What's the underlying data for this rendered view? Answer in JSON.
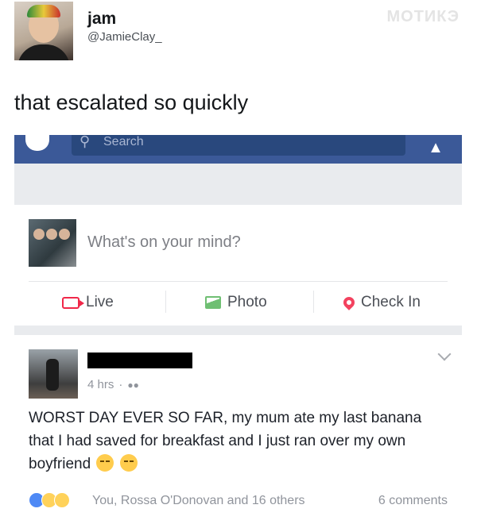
{
  "tweet": {
    "display_name": "jam",
    "handle": "@JamieClay_",
    "text": "that escalated so quickly",
    "watermark": "MOTИКЭ"
  },
  "facebook": {
    "search_placeholder": "Search",
    "composer": {
      "placeholder": "What's on your mind?",
      "actions": {
        "live": "Live",
        "photo": "Photo",
        "checkin": "Check In"
      }
    },
    "post": {
      "time": "4 hrs",
      "separator": "·",
      "body": "WORST DAY EVER SO FAR, my mum ate my last banana that I had saved for breakfast and I just ran over my own boyfriend",
      "reactions_text": "You, Rossa O'Donovan and 16 others",
      "comments_text": "6 comments"
    },
    "colors": {
      "topbar": "#3b5998",
      "background": "#e9ebee"
    },
    "icons": [
      "messenger-icon",
      "search-icon",
      "friend-requests-icon",
      "live-video-icon",
      "photo-icon",
      "location-pin-icon",
      "friends-audience-icon",
      "chevron-down-icon",
      "like-reaction-icon",
      "haha-reaction-icon",
      "wow-reaction-icon"
    ]
  }
}
